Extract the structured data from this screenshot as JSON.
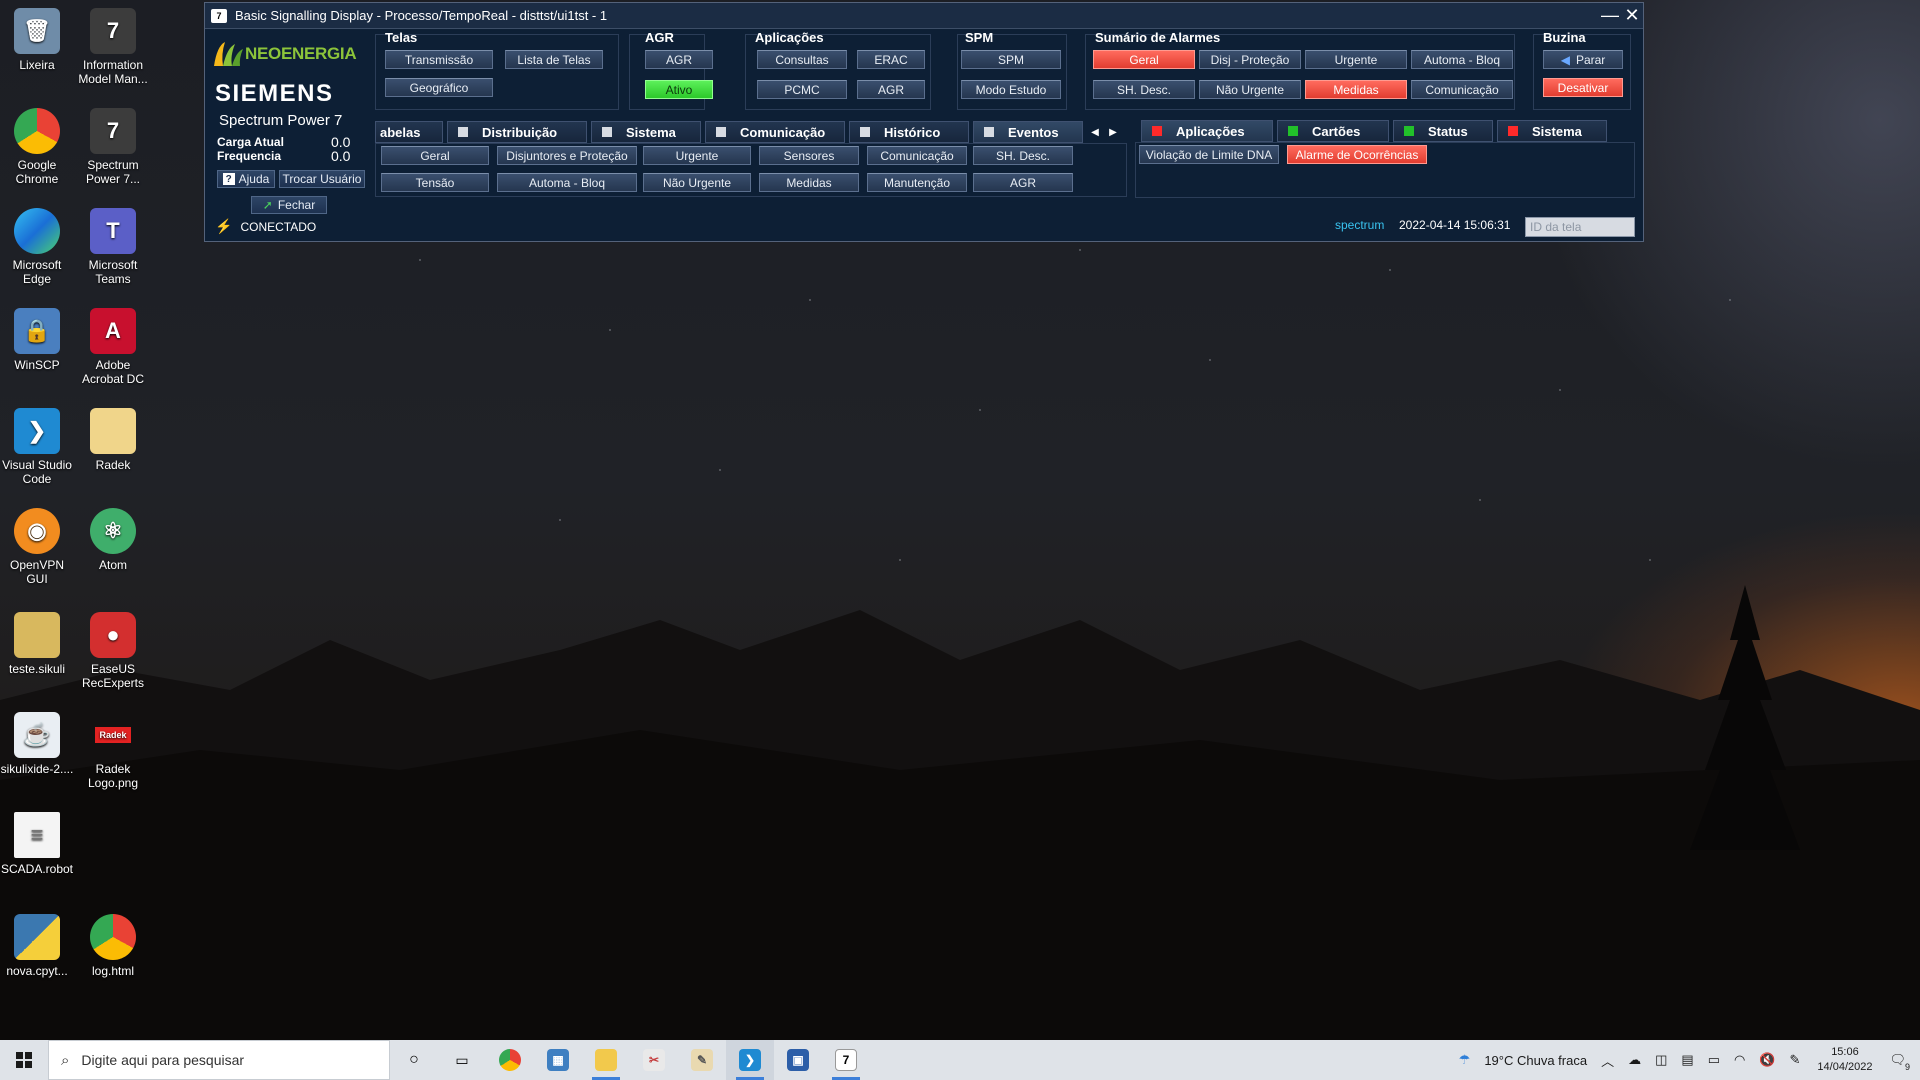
{
  "window": {
    "title": "Basic Signalling Display - Processo/TempoReal - disttst/ui1tst - 1",
    "minimize": "—",
    "close": "✕"
  },
  "brand": {
    "neoenergia": "NEOENERGIA",
    "siemens": "SIEMENS",
    "product": "Spectrum Power 7"
  },
  "left": {
    "carga_label": "Carga Atual",
    "carga_value": "0.0",
    "freq_label": "Frequencia",
    "freq_value": "0.0",
    "ajuda": "Ajuda",
    "trocar": "Trocar Usuário",
    "fechar": "Fechar",
    "conectado": "CONECTADO"
  },
  "telas": {
    "title": "Telas",
    "transmissao": "Transmissão",
    "lista": "Lista de Telas",
    "geografico": "Geográfico"
  },
  "agr": {
    "title": "AGR",
    "agr": "AGR",
    "ativo": "Ativo"
  },
  "aplicacoes": {
    "title": "Aplicações",
    "consultas": "Consultas",
    "erac": "ERAC",
    "pcmc": "PCMC",
    "agr": "AGR"
  },
  "spm": {
    "title": "SPM",
    "spm": "SPM",
    "modo": "Modo Estudo"
  },
  "alarmes": {
    "title": "Sumário de Alarmes",
    "geral": "Geral",
    "disj": "Disj - Proteção",
    "urgente": "Urgente",
    "automa": "Automa - Bloq",
    "shdesc": "SH. Desc.",
    "naourgente": "Não Urgente",
    "medidas": "Medidas",
    "comunicacao": "Comunicação"
  },
  "buzina": {
    "title": "Buzina",
    "parar": "Parar",
    "desativar": "Desativar"
  },
  "tabs_left": [
    {
      "label": "abelas"
    },
    {
      "label": "Distribuição"
    },
    {
      "label": "Sistema"
    },
    {
      "label": "Comunicação"
    },
    {
      "label": "Histórico"
    },
    {
      "label": "Eventos"
    }
  ],
  "tabs_right": [
    {
      "label": "Aplicações"
    },
    {
      "label": "Cartões"
    },
    {
      "label": "Status"
    },
    {
      "label": "Sistema"
    }
  ],
  "eventos": {
    "row1": [
      "Geral",
      "Disjuntores e Proteção",
      "Urgente",
      "Sensores",
      "Comunicação",
      "SH. Desc."
    ],
    "row2": [
      "Tensão",
      "Automa - Bloq",
      "Não Urgente",
      "Medidas",
      "Manutenção",
      "AGR"
    ]
  },
  "aplic_panel": {
    "violacao": "Violação de Limite DNA",
    "alarme": "Alarme de Ocorrências"
  },
  "status": {
    "user": "spectrum",
    "datetime": "2022-04-14 15:06:31",
    "id_placeholder": "ID da tela"
  },
  "desktop": [
    {
      "label": "Lixeira"
    },
    {
      "label": "Information Model Man..."
    },
    {
      "label": "Google Chrome"
    },
    {
      "label": "Spectrum Power 7..."
    },
    {
      "label": "Microsoft Edge"
    },
    {
      "label": "Microsoft Teams"
    },
    {
      "label": "WinSCP"
    },
    {
      "label": "Adobe Acrobat DC"
    },
    {
      "label": "Visual Studio Code"
    },
    {
      "label": "Radek"
    },
    {
      "label": "OpenVPN GUI"
    },
    {
      "label": "Atom"
    },
    {
      "label": "teste.sikuli"
    },
    {
      "label": "EaseUS RecExperts"
    },
    {
      "label": "sikulixide-2...."
    },
    {
      "label": "Radek Logo.png"
    },
    {
      "label": "SCADA.robot"
    },
    {
      "label": "nova.cpyt..."
    },
    {
      "label": "log.html"
    }
  ],
  "taskbar": {
    "search_placeholder": "Digite aqui para pesquisar",
    "weather": "19°C  Chuva fraca",
    "time": "15:06",
    "date": "14/04/2022",
    "notif_count": "9"
  },
  "colors": {
    "alarm_red": "#e23d30",
    "ok_green": "#2cc82a",
    "brand_green": "#8cc43a"
  }
}
